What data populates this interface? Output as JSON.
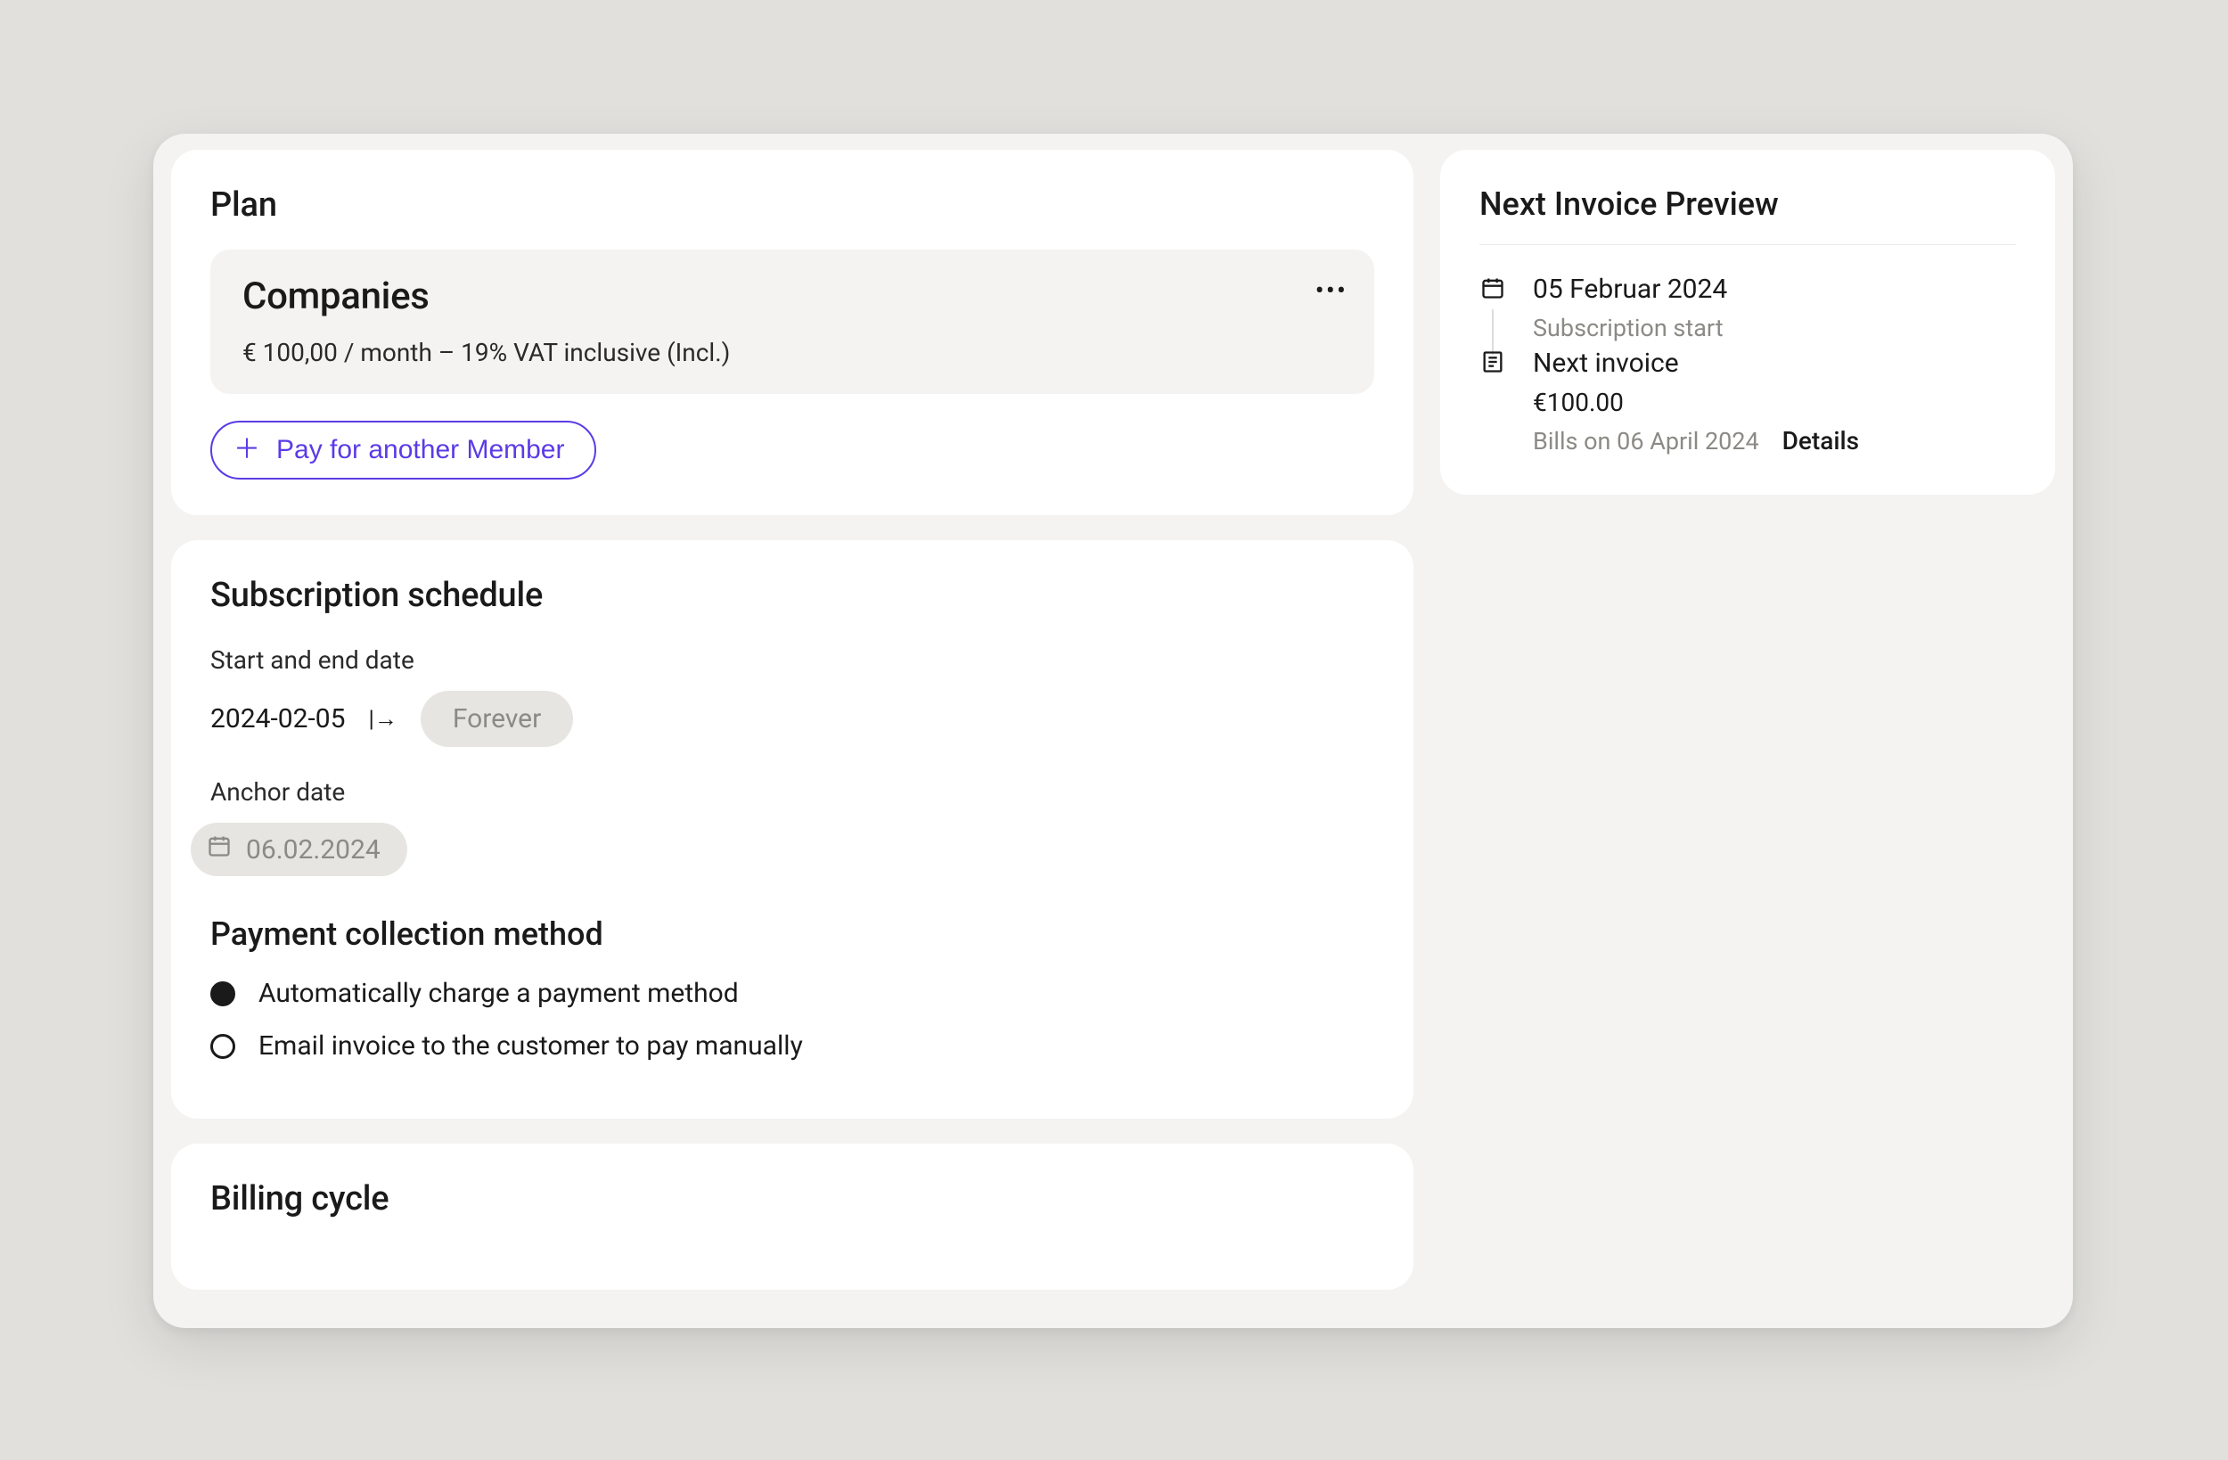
{
  "plan": {
    "section_title": "Plan",
    "name": "Companies",
    "price_line": "€ 100,00 / month – 19% VAT inclusive (Incl.)",
    "more_icon_name": "more-horizontal-icon",
    "pay_button_label": "Pay for another Member"
  },
  "schedule": {
    "section_title": "Subscription schedule",
    "date_label": "Start and end date",
    "start_date": "2024-02-05",
    "end_date_chip": "Forever",
    "arrow_glyph": "|→",
    "anchor_label": "Anchor date",
    "anchor_value": "06.02.2024",
    "method_title": "Payment collection method",
    "methods": [
      {
        "label": "Automatically charge a payment method",
        "selected": true
      },
      {
        "label": "Email invoice to the customer to pay manually",
        "selected": false
      }
    ]
  },
  "billing": {
    "section_title": "Billing cycle"
  },
  "preview": {
    "section_title": "Next Invoice Preview",
    "start": {
      "date": "05 Februar 2024",
      "label": "Subscription start"
    },
    "next": {
      "title": "Next invoice",
      "amount": "€100.00",
      "bills_on": "Bills on 06 April 2024",
      "details_label": "Details"
    }
  }
}
